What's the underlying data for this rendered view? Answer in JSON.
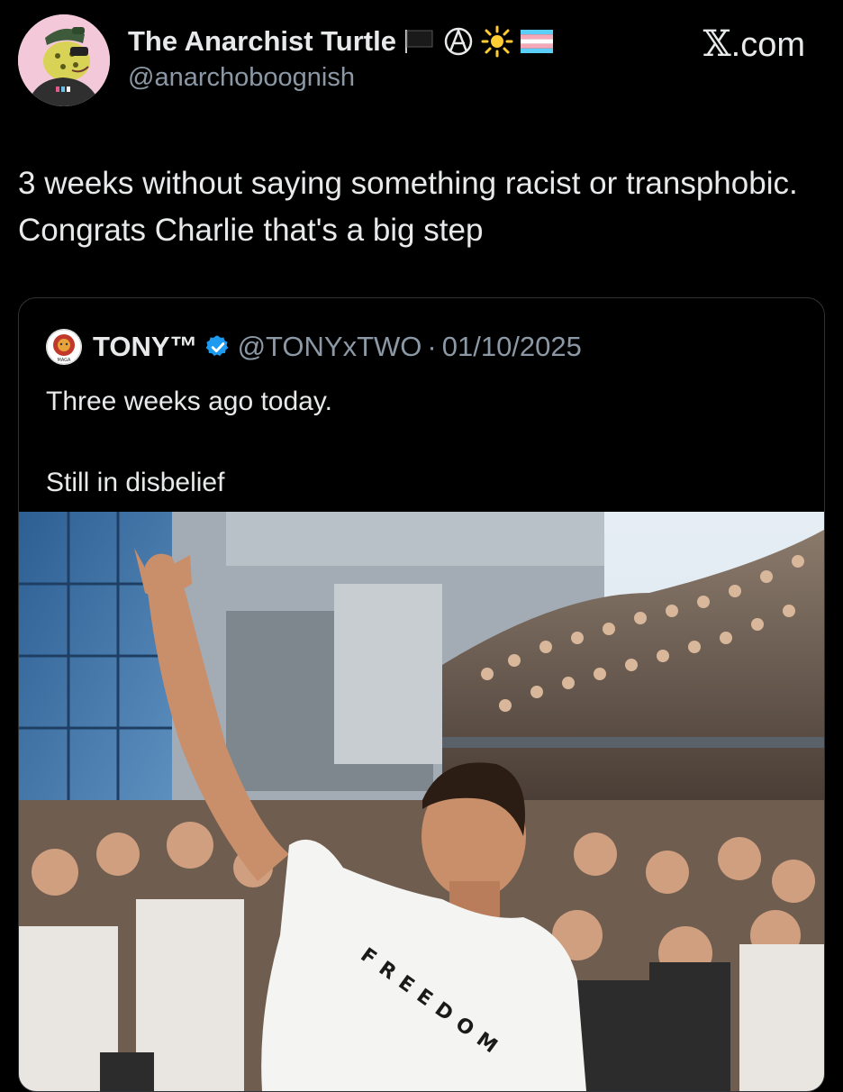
{
  "brand": {
    "mark": "𝕏",
    "suffix": ".com"
  },
  "author": {
    "display_name": "The Anarchist Turtle",
    "handle": "@anarchoboognish",
    "badges": [
      "black-flag-icon",
      "anarchy-a-icon",
      "sun-icon",
      "transgender-flag-icon"
    ]
  },
  "tweet": {
    "text": "3 weeks without saying something racist or transphobic. Congrats Charlie that's a big step"
  },
  "quoted_tweet": {
    "display_name": "TONY™",
    "verified": true,
    "handle": "@TONYxTWO",
    "separator": "·",
    "date": "01/10/2025",
    "text": "Three weeks ago today.\n\nStill in disbelief",
    "avatar_text": "MAGA",
    "photo": {
      "shirt_text": "FREEDOM",
      "colors": {
        "sky": "#dfe8f0",
        "building": "#9aa3ad",
        "glass": "#3f74a8",
        "shirt": "#f4f4f2",
        "skin": "#c98e6a"
      }
    }
  },
  "colors": {
    "background": "#000000",
    "text": "#e7e9ea",
    "secondary": "#8b98a5",
    "border": "#2f3336",
    "verified": "#1d9bf0"
  }
}
